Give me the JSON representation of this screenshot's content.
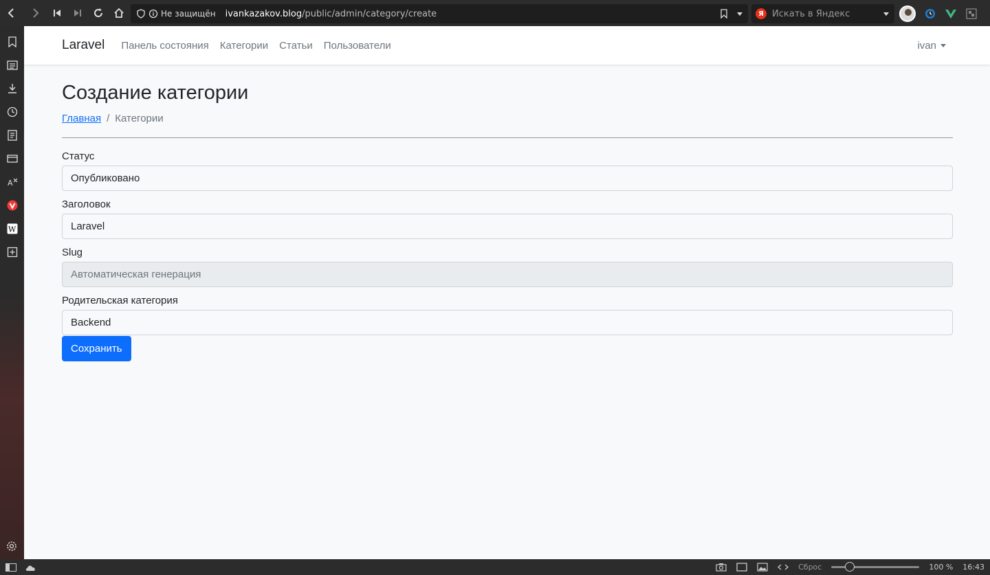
{
  "browser": {
    "security_label": "Не защищён",
    "url_host": "ivankazakov.blog",
    "url_path": "/public/admin/category/create",
    "search_placeholder": "Искать в Яндекс",
    "yandex_letter": "Я"
  },
  "status_bar": {
    "reset_label": "Сброс",
    "zoom": "100 %",
    "time": "16:43"
  },
  "navbar": {
    "brand": "Laravel",
    "links": [
      "Панель состояния",
      "Категории",
      "Статьи",
      "Пользователи"
    ],
    "user": "ivan"
  },
  "page": {
    "title": "Создание категории",
    "breadcrumb": {
      "home": "Главная",
      "separator": "/",
      "current": "Категории"
    }
  },
  "form": {
    "status": {
      "label": "Статус",
      "value": "Опубликовано"
    },
    "heading": {
      "label": "Заголовок",
      "value": "Laravel"
    },
    "slug": {
      "label": "Slug",
      "value": "Автоматическая генерация"
    },
    "parent": {
      "label": "Родительская категория",
      "value": "Backend"
    },
    "submit": "Сохранить"
  },
  "colors": {
    "primary": "#0d6efd",
    "page_bg": "#f8f9fa",
    "chrome_bg": "#2c2c2c"
  }
}
